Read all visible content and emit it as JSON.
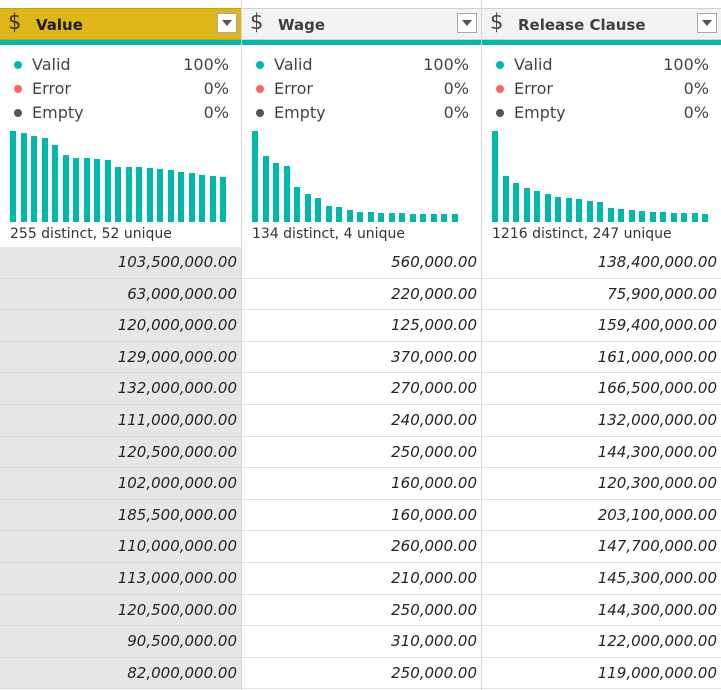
{
  "colors": {
    "accent": "#01b8aa",
    "selected_header": "#dfb619",
    "error_dot": "#fd625e",
    "empty_dot": "#555555"
  },
  "columns": [
    {
      "type_icon": "dollar-icon",
      "type_symbol": "$",
      "title": "Value",
      "selected": true,
      "quality": {
        "valid_label": "Valid",
        "valid_pct": "100%",
        "error_label": "Error",
        "error_pct": "0%",
        "empty_label": "Empty",
        "empty_pct": "0%"
      },
      "histogram": [
        1.0,
        0.98,
        0.95,
        0.92,
        0.85,
        0.74,
        0.7,
        0.7,
        0.69,
        0.68,
        0.6,
        0.6,
        0.6,
        0.59,
        0.58,
        0.57,
        0.55,
        0.54,
        0.52,
        0.51,
        0.49
      ],
      "distinct_text": "255 distinct, 52 unique",
      "values": [
        "103,500,000.00",
        "63,000,000.00",
        "120,000,000.00",
        "129,000,000.00",
        "132,000,000.00",
        "111,000,000.00",
        "120,500,000.00",
        "102,000,000.00",
        "185,500,000.00",
        "110,000,000.00",
        "113,000,000.00",
        "120,500,000.00",
        "90,500,000.00",
        "82,000,000.00"
      ]
    },
    {
      "type_icon": "dollar-icon",
      "type_symbol": "$",
      "title": "Wage",
      "selected": false,
      "quality": {
        "valid_label": "Valid",
        "valid_pct": "100%",
        "error_label": "Error",
        "error_pct": "0%",
        "empty_label": "Empty",
        "empty_pct": "0%"
      },
      "histogram": [
        1.0,
        0.73,
        0.65,
        0.61,
        0.38,
        0.31,
        0.26,
        0.18,
        0.16,
        0.13,
        0.11,
        0.11,
        0.1,
        0.1,
        0.1,
        0.09,
        0.09,
        0.09,
        0.09,
        0.09
      ],
      "distinct_text": "134 distinct, 4 unique",
      "values": [
        "560,000.00",
        "220,000.00",
        "125,000.00",
        "370,000.00",
        "270,000.00",
        "240,000.00",
        "250,000.00",
        "160,000.00",
        "160,000.00",
        "260,000.00",
        "210,000.00",
        "250,000.00",
        "310,000.00",
        "250,000.00"
      ]
    },
    {
      "type_icon": "dollar-icon",
      "type_symbol": "$",
      "title": "Release Clause",
      "selected": false,
      "quality": {
        "valid_label": "Valid",
        "valid_pct": "100%",
        "error_label": "Error",
        "error_pct": "0%",
        "empty_label": "Empty",
        "empty_pct": "0%"
      },
      "histogram": [
        1.0,
        0.51,
        0.43,
        0.37,
        0.34,
        0.31,
        0.28,
        0.26,
        0.25,
        0.23,
        0.22,
        0.15,
        0.14,
        0.13,
        0.12,
        0.11,
        0.11,
        0.1,
        0.1,
        0.1,
        0.09
      ],
      "distinct_text": "1216 distinct, 247 unique",
      "values": [
        "138,400,000.00",
        "75,900,000.00",
        "159,400,000.00",
        "161,000,000.00",
        "166,500,000.00",
        "132,000,000.00",
        "144,300,000.00",
        "120,300,000.00",
        "203,100,000.00",
        "147,700,000.00",
        "145,300,000.00",
        "144,300,000.00",
        "122,000,000.00",
        "119,000,000.00"
      ]
    }
  ]
}
